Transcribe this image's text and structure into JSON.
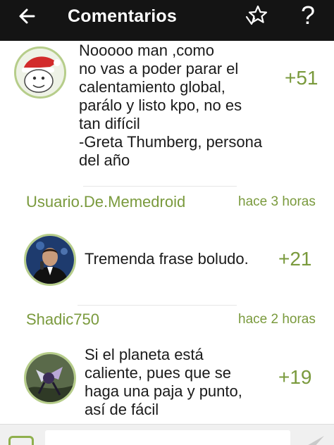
{
  "header": {
    "title": "Comentarios",
    "back_icon": "arrow-left-icon",
    "favorite_icon": "star-icon",
    "help_label": "?"
  },
  "comments": [
    {
      "text": "Nooooo man ,como\nno vas a poder parar el\ncalentamiento global,\nparálo y listo kpo, no es\ntan difícil\n-Greta Thumberg, persona\ndel año",
      "score": "+51"
    },
    {
      "username": "Usuario.De.Memedroid",
      "time": "hace 3 horas",
      "text": "Tremenda frase boludo.",
      "score": "+21"
    },
    {
      "username": "Shadic750",
      "time": "hace 2 horas",
      "text": "Si el planeta está\ncaliente, pues que se\nhaga una paja y punto,\nasí de fácil",
      "score": "+19"
    }
  ],
  "composer": {
    "placeholder": "",
    "emoji_icon": "emoji-icon",
    "send_icon": "send-icon"
  },
  "colors": {
    "topbar": "#141414",
    "accent_green": "#7a9a3d",
    "avatar_ring": "#b6cd8a"
  }
}
